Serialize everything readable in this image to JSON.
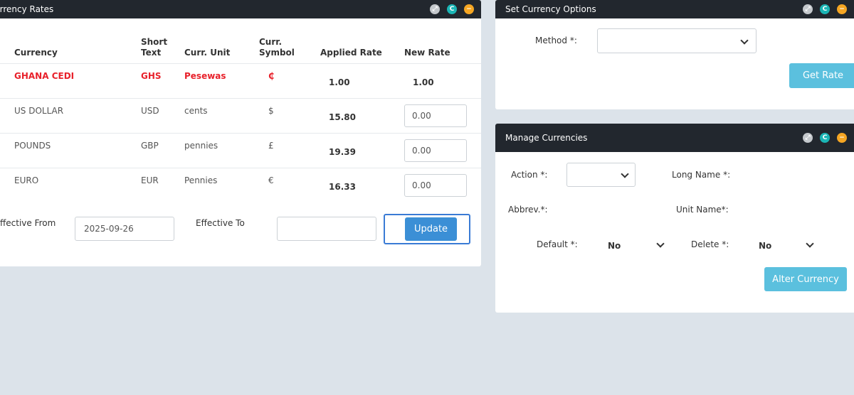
{
  "currency_rates": {
    "title": "urrency Rates",
    "columns": {
      "currency": "Currency",
      "short_text_1": "Short",
      "short_text_2": "Text",
      "curr_unit": "Curr. Unit",
      "curr_symbol_1": "Curr.",
      "curr_symbol_2": "Symbol",
      "applied_rate": "Applied Rate",
      "new_rate": "New Rate"
    },
    "rows": [
      {
        "currency": "GHANA CEDI",
        "short": "GHS",
        "unit": "Pesewas",
        "symbol": "₵",
        "applied": "1.00",
        "new_rate": "1.00"
      },
      {
        "currency": "US DOLLAR",
        "short": "USD",
        "unit": "cents",
        "symbol": "$",
        "applied": "15.80",
        "new_rate": "0.00"
      },
      {
        "currency": "POUNDS",
        "short": "GBP",
        "unit": "pennies",
        "symbol": "£",
        "applied": "19.39",
        "new_rate": "0.00"
      },
      {
        "currency": "EURO",
        "short": "EUR",
        "unit": "Pennies",
        "symbol": "€",
        "applied": "16.33",
        "new_rate": "0.00"
      }
    ],
    "effective_from_label": "ffective From",
    "effective_from_value": "2025-09-26",
    "effective_to_label": "Effective To",
    "effective_to_value": "",
    "update_label": "Update"
  },
  "set_currency_options": {
    "title": "Set Currency Options",
    "method_label": "Method *:",
    "method_value": "",
    "get_rate_label": "Get Rate"
  },
  "manage_currencies": {
    "title": "Manage Currencies",
    "action_label": "Action *:",
    "action_value": "",
    "long_name_label": "Long Name *:",
    "abbrev_label": "Abbrev.*:",
    "unit_name_label": "Unit Name*:",
    "default_label": "Default *:",
    "default_value": "No",
    "delete_label": "Delete *:",
    "delete_value": "No",
    "alter_label": "Alter Currency"
  },
  "icons": [
    "expand-icon",
    "refresh-icon",
    "collapse-icon"
  ],
  "colors": {
    "header": "#22272e",
    "base_currency": "#e8212b",
    "primary": "#3b8fd6",
    "info": "#5bc0de"
  }
}
